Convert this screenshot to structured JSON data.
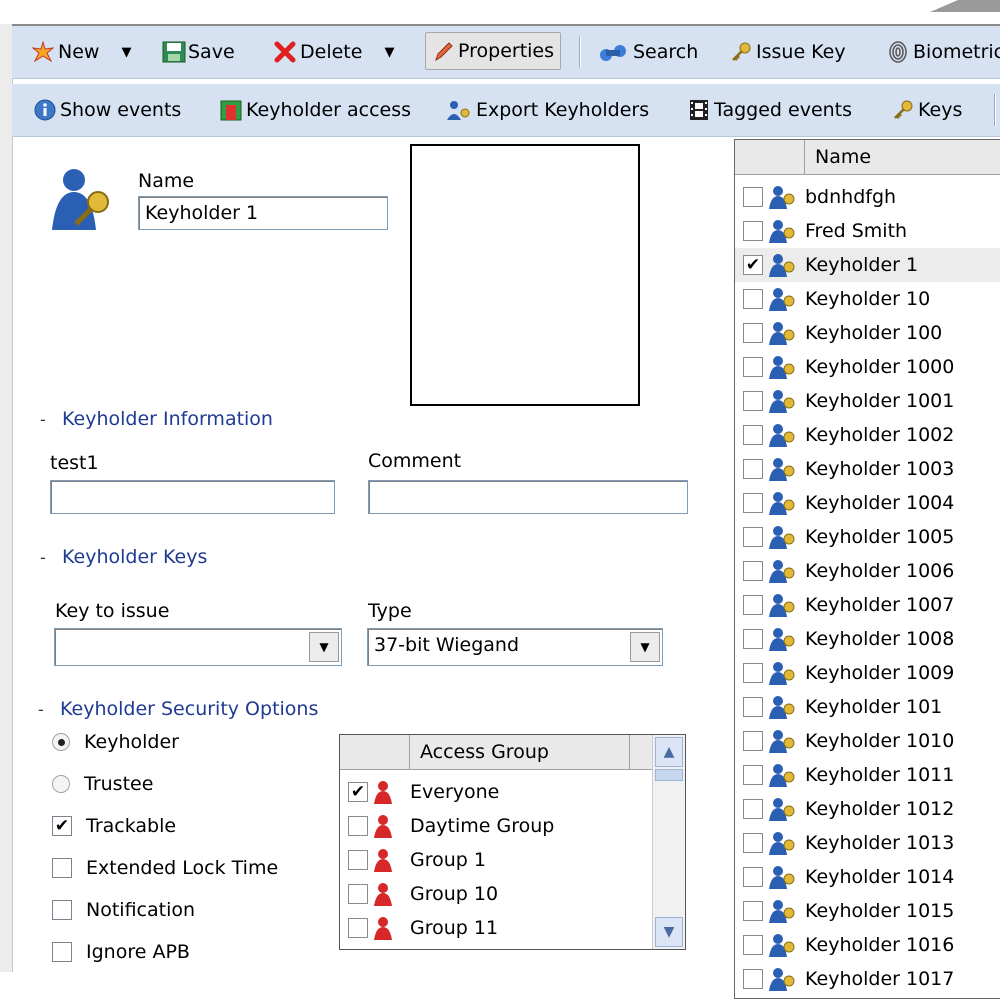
{
  "toolbar1": [
    {
      "label": "New",
      "icon": "new-icon",
      "dropdown": true
    },
    {
      "label": "Save",
      "icon": "save-icon",
      "dropdown": false
    },
    {
      "label": "Delete",
      "icon": "delete-icon",
      "dropdown": true
    },
    {
      "label": "Properties",
      "icon": "properties-icon",
      "dropdown": false,
      "pressed": true
    },
    {
      "label": "Search",
      "icon": "search-icon",
      "dropdown": false
    },
    {
      "label": "Issue Key",
      "icon": "key-icon",
      "dropdown": false
    },
    {
      "label": "Biometric",
      "icon": "biometric-icon",
      "dropdown": false
    }
  ],
  "toolbar2": [
    {
      "label": "Show events",
      "icon": "info-icon"
    },
    {
      "label": "Keyholder access",
      "icon": "access-icon"
    },
    {
      "label": "Export Keyholders",
      "icon": "export-icon"
    },
    {
      "label": "Tagged events",
      "icon": "film-icon"
    },
    {
      "label": "Keys",
      "icon": "key-icon"
    }
  ],
  "form": {
    "name_label": "Name",
    "name_value": "Keyholder 1",
    "info_section": "Keyholder Information",
    "field1_label": "test1",
    "field1_value": "",
    "comment_label": "Comment",
    "comment_value": "",
    "keys_section": "Keyholder Keys",
    "key_to_issue_label": "Key to issue",
    "key_to_issue_value": "",
    "type_label": "Type",
    "type_value": "37-bit Wiegand",
    "security_section": "Keyholder Security Options",
    "section_toggle": "-"
  },
  "security_options": [
    {
      "label": "Keyholder",
      "kind": "radio",
      "checked": true
    },
    {
      "label": "Trustee",
      "kind": "radio",
      "checked": false
    },
    {
      "label": "Trackable",
      "kind": "checkbox",
      "checked": true
    },
    {
      "label": "Extended Lock Time",
      "kind": "checkbox",
      "checked": false
    },
    {
      "label": "Notification",
      "kind": "checkbox",
      "checked": false
    },
    {
      "label": "Ignore APB",
      "kind": "checkbox",
      "checked": false
    }
  ],
  "access_groups": {
    "header": "Access Group",
    "rows": [
      {
        "label": "Everyone",
        "checked": true
      },
      {
        "label": "Daytime Group",
        "checked": false
      },
      {
        "label": "Group 1",
        "checked": false
      },
      {
        "label": "Group 10",
        "checked": false
      },
      {
        "label": "Group 11",
        "checked": false
      }
    ]
  },
  "keyholders": {
    "header": "Name",
    "selected": "Keyholder 1",
    "rows": [
      {
        "label": "bdnhdfgh",
        "checked": false
      },
      {
        "label": "Fred Smith",
        "checked": false
      },
      {
        "label": "Keyholder 1",
        "checked": true
      },
      {
        "label": "Keyholder 10",
        "checked": false
      },
      {
        "label": "Keyholder 100",
        "checked": false
      },
      {
        "label": "Keyholder 1000",
        "checked": false
      },
      {
        "label": "Keyholder 1001",
        "checked": false
      },
      {
        "label": "Keyholder 1002",
        "checked": false
      },
      {
        "label": "Keyholder 1003",
        "checked": false
      },
      {
        "label": "Keyholder 1004",
        "checked": false
      },
      {
        "label": "Keyholder 1005",
        "checked": false
      },
      {
        "label": "Keyholder 1006",
        "checked": false
      },
      {
        "label": "Keyholder 1007",
        "checked": false
      },
      {
        "label": "Keyholder 1008",
        "checked": false
      },
      {
        "label": "Keyholder 1009",
        "checked": false
      },
      {
        "label": "Keyholder 101",
        "checked": false
      },
      {
        "label": "Keyholder 1010",
        "checked": false
      },
      {
        "label": "Keyholder 1011",
        "checked": false
      },
      {
        "label": "Keyholder 1012",
        "checked": false
      },
      {
        "label": "Keyholder 1013",
        "checked": false
      },
      {
        "label": "Keyholder 1014",
        "checked": false
      },
      {
        "label": "Keyholder 1015",
        "checked": false
      },
      {
        "label": "Keyholder 1016",
        "checked": false
      },
      {
        "label": "Keyholder 1017",
        "checked": false
      }
    ]
  },
  "colors": {
    "toolbar": "#d6e1f2",
    "section": "#1f3a93",
    "selected_row": "#ececec"
  }
}
